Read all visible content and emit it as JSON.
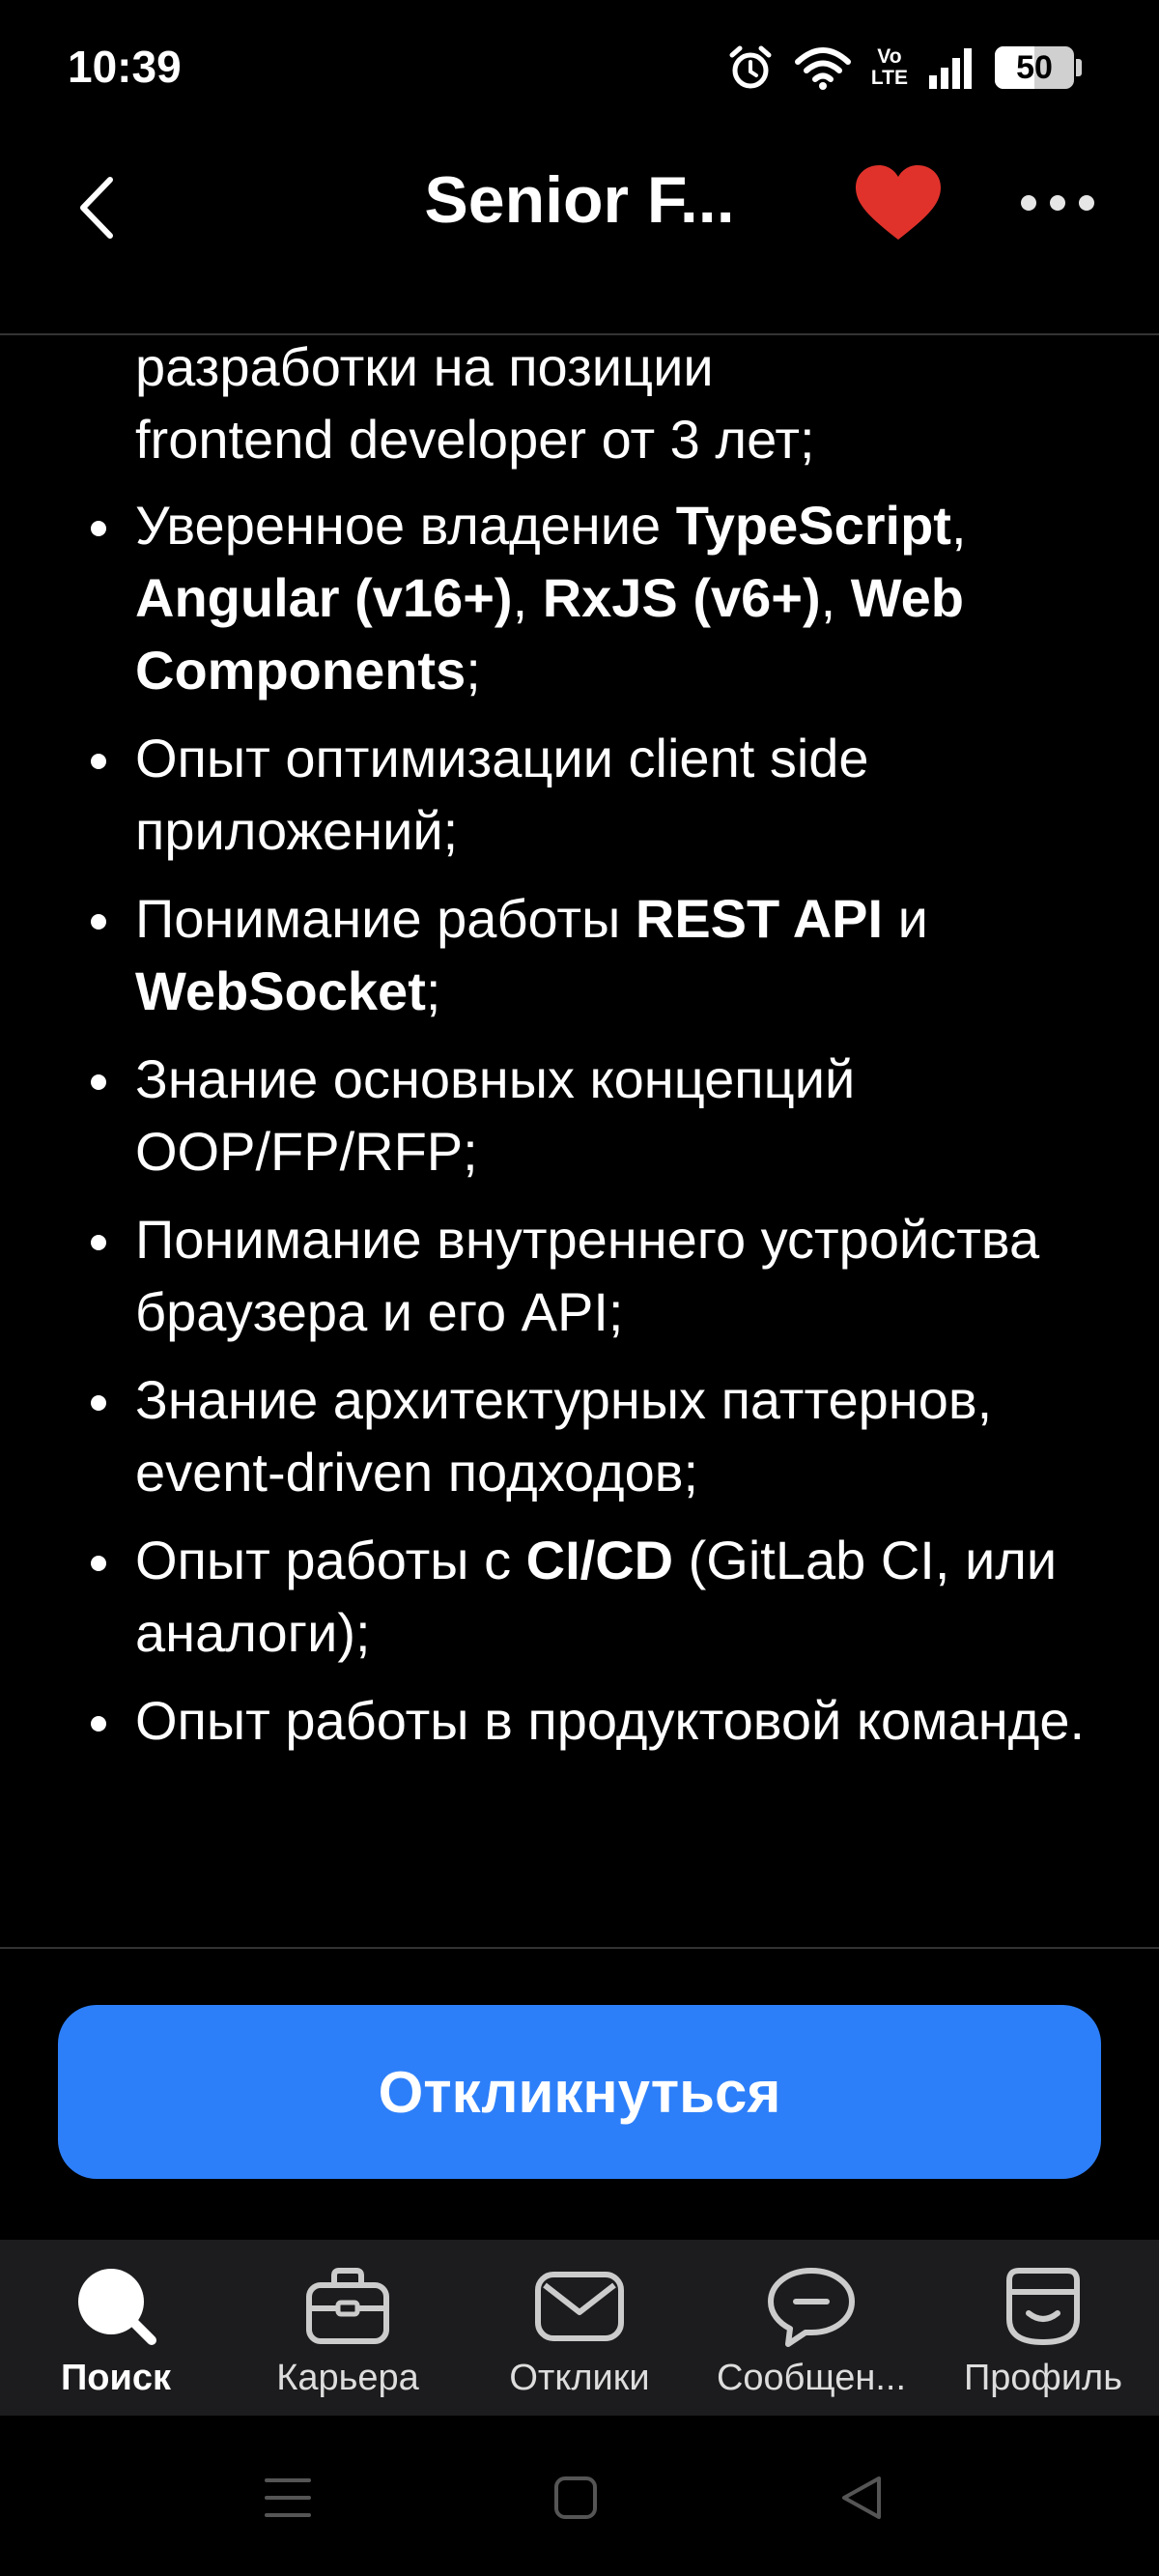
{
  "status_bar": {
    "time": "10:39",
    "volte_top": "Vo",
    "volte_bottom": "LTE",
    "battery_level": "50",
    "battery_fraction": 0.5
  },
  "header": {
    "title": "Senior F...",
    "back_icon": "chevron-left-icon",
    "favorite_icon": "heart-icon",
    "favorite_color": "#e0322b",
    "more_icon": "more-horizontal-icon"
  },
  "requirements": {
    "lead_line_1": "разработки на позиции",
    "lead_line_2": "frontend developer от 3 лет;",
    "items": [
      {
        "parts": [
          "Уверенное владение ",
          "TypeScript",
          ", ",
          "Angular (v16+)",
          ", ",
          "RxJS (v6+)",
          ", ",
          "Web Components",
          ";"
        ]
      },
      {
        "parts": [
          "Опыт оптимизации client side приложений;"
        ]
      },
      {
        "parts": [
          "Понимание работы ",
          "REST API",
          " и ",
          "WebSocket",
          ";"
        ]
      },
      {
        "parts": [
          "Знание основных концепций OOP/FP/RFP;"
        ]
      },
      {
        "parts": [
          "Понимание внутреннего устройства браузера и его API;"
        ]
      },
      {
        "parts": [
          "Знание архитектурных паттернов, event-driven подходов;"
        ]
      },
      {
        "parts": [
          "Опыт работы с ",
          "CI/CD",
          " (GitLab CI, или аналоги);"
        ]
      },
      {
        "parts": [
          "Опыт работы в продуктовой команде."
        ]
      }
    ]
  },
  "apply_button": {
    "label": "Откликнуться",
    "color": "#2d7ff9"
  },
  "bottom_nav": {
    "items": [
      {
        "label": "Поиск",
        "icon": "search-icon",
        "active": true
      },
      {
        "label": "Карьера",
        "icon": "briefcase-icon",
        "active": false
      },
      {
        "label": "Отклики",
        "icon": "mail-icon",
        "active": false
      },
      {
        "label": "Сообщен...",
        "icon": "chat-icon",
        "active": false
      },
      {
        "label": "Профиль",
        "icon": "profile-icon",
        "active": false
      }
    ]
  },
  "system_nav": {
    "menu_icon": "menu-icon",
    "home_icon": "home-icon",
    "back_icon": "back-triangle-icon"
  }
}
